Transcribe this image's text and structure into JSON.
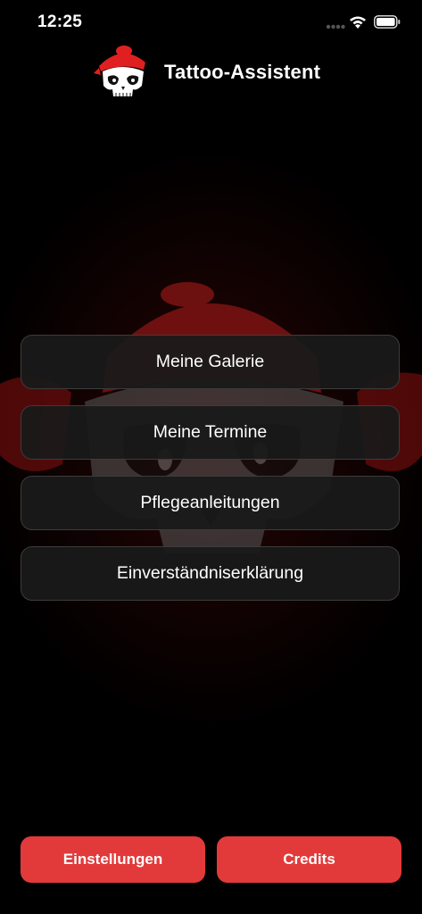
{
  "status_bar": {
    "time": "12:25"
  },
  "header": {
    "title": "Tattoo-Assistent",
    "logo_icon": "skull-with-red-bandana-icon"
  },
  "menu": {
    "items": [
      {
        "label": "Meine Galerie"
      },
      {
        "label": "Meine Termine"
      },
      {
        "label": "Pflegeanleitungen"
      },
      {
        "label": "Einverständniserklärung"
      }
    ]
  },
  "bottom": {
    "settings_label": "Einstellungen",
    "credits_label": "Credits"
  },
  "colors": {
    "accent": "#e23a3a",
    "button_bg": "#1a1a1a",
    "background": "#000000"
  }
}
